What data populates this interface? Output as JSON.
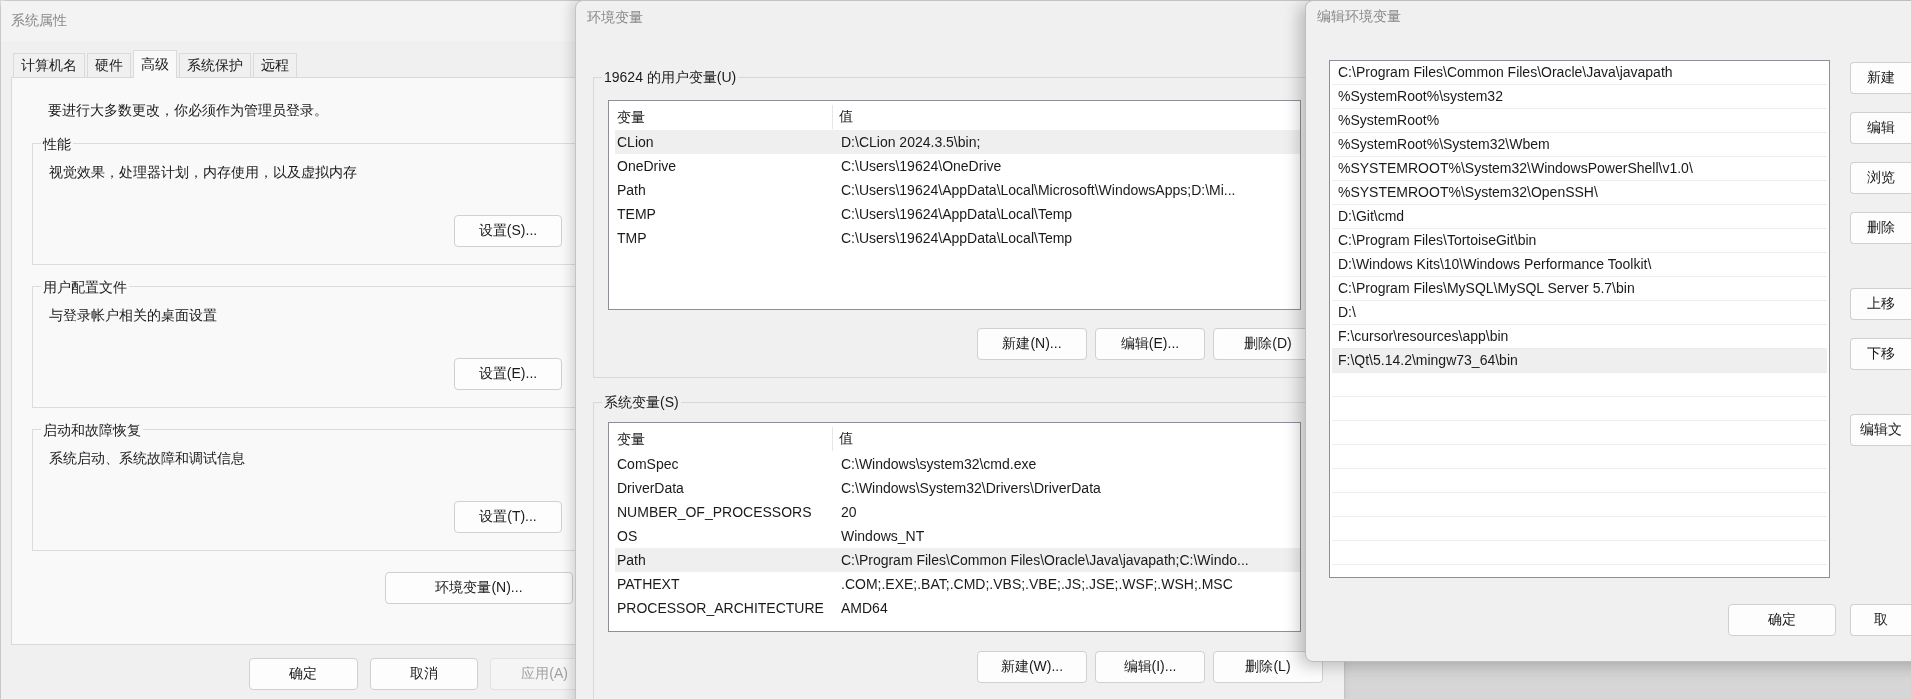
{
  "system_properties": {
    "title": "系统属性",
    "tabs": [
      {
        "label": "计算机名",
        "selected": false
      },
      {
        "label": "硬件",
        "selected": false
      },
      {
        "label": "高级",
        "selected": true
      },
      {
        "label": "系统保护",
        "selected": false
      },
      {
        "label": "远程",
        "selected": false
      }
    ],
    "notice": "要进行大多数更改，你必须作为管理员登录。",
    "groups": [
      {
        "title": "性能",
        "description": "视觉效果，处理器计划，内存使用，以及虚拟内存",
        "button": "设置(S)..."
      },
      {
        "title": "用户配置文件",
        "description": "与登录帐户相关的桌面设置",
        "button": "设置(E)..."
      },
      {
        "title": "启动和故障恢复",
        "description": "系统启动、系统故障和调试信息",
        "button": "设置(T)..."
      }
    ],
    "env_button": "环境变量(N)...",
    "buttons": [
      {
        "label": "确定",
        "disabled": false
      },
      {
        "label": "取消",
        "disabled": false
      },
      {
        "label": "应用(A)",
        "disabled": true
      }
    ]
  },
  "environment_variables": {
    "title": "环境变量",
    "sections": [
      {
        "title": "19624 的用户变量(U)",
        "columns": [
          "变量",
          "值"
        ],
        "rows": [
          {
            "name": "CLion",
            "value": "D:\\CLion 2024.3.5\\bin;",
            "selected": true
          },
          {
            "name": "OneDrive",
            "value": "C:\\Users\\19624\\OneDrive",
            "selected": false
          },
          {
            "name": "Path",
            "value": "C:\\Users\\19624\\AppData\\Local\\Microsoft\\WindowsApps;D:\\Mi...",
            "selected": false
          },
          {
            "name": "TEMP",
            "value": "C:\\Users\\19624\\AppData\\Local\\Temp",
            "selected": false
          },
          {
            "name": "TMP",
            "value": "C:\\Users\\19624\\AppData\\Local\\Temp",
            "selected": false
          }
        ],
        "buttons": [
          "新建(N)...",
          "编辑(E)...",
          "删除(D)"
        ]
      },
      {
        "title": "系统变量(S)",
        "columns": [
          "变量",
          "值"
        ],
        "rows": [
          {
            "name": "ComSpec",
            "value": "C:\\Windows\\system32\\cmd.exe",
            "selected": false
          },
          {
            "name": "DriverData",
            "value": "C:\\Windows\\System32\\Drivers\\DriverData",
            "selected": false
          },
          {
            "name": "NUMBER_OF_PROCESSORS",
            "value": "20",
            "selected": false
          },
          {
            "name": "OS",
            "value": "Windows_NT",
            "selected": false
          },
          {
            "name": "Path",
            "value": "C:\\Program Files\\Common Files\\Oracle\\Java\\javapath;C:\\Windo...",
            "selected": true
          },
          {
            "name": "PATHEXT",
            "value": ".COM;.EXE;.BAT;.CMD;.VBS;.VBE;.JS;.JSE;.WSF;.WSH;.MSC",
            "selected": false
          },
          {
            "name": "PROCESSOR_ARCHITECTURE",
            "value": "AMD64",
            "selected": false
          }
        ],
        "buttons": [
          "新建(W)...",
          "编辑(I)...",
          "删除(L)"
        ]
      }
    ]
  },
  "edit_environment_variable": {
    "title": "编辑环境变量",
    "entries": [
      {
        "text": "C:\\Program Files\\Common Files\\Oracle\\Java\\javapath",
        "selected": false
      },
      {
        "text": "%SystemRoot%\\system32",
        "selected": false
      },
      {
        "text": "%SystemRoot%",
        "selected": false
      },
      {
        "text": "%SystemRoot%\\System32\\Wbem",
        "selected": false
      },
      {
        "text": "%SYSTEMROOT%\\System32\\WindowsPowerShell\\v1.0\\",
        "selected": false
      },
      {
        "text": "%SYSTEMROOT%\\System32\\OpenSSH\\",
        "selected": false
      },
      {
        "text": "D:\\Git\\cmd",
        "selected": false
      },
      {
        "text": "C:\\Program Files\\TortoiseGit\\bin",
        "selected": false
      },
      {
        "text": "D:\\Windows Kits\\10\\Windows Performance Toolkit\\",
        "selected": false
      },
      {
        "text": "C:\\Program Files\\MySQL\\MySQL Server 5.7\\bin",
        "selected": false
      },
      {
        "text": "D:\\",
        "selected": false
      },
      {
        "text": "F:\\cursor\\resources\\app\\bin",
        "selected": false
      },
      {
        "text": "F:\\Qt\\5.14.2\\mingw73_64\\bin",
        "selected": true
      }
    ],
    "side_button_groups": [
      [
        "新建",
        "编辑",
        "浏览",
        "删除"
      ],
      [
        "上移",
        "下移"
      ],
      [
        "编辑文"
      ]
    ],
    "buttons": [
      "确定",
      "取"
    ]
  }
}
